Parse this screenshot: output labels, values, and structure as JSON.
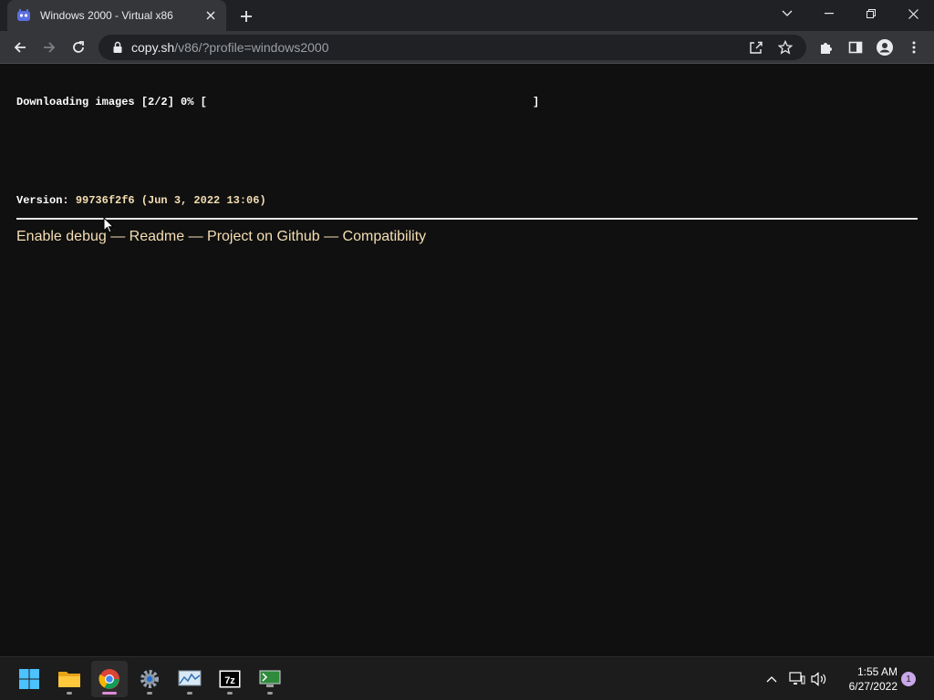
{
  "browser": {
    "tab": {
      "title": "Windows 2000 - Virtual x86",
      "favicon": "v86-icon"
    },
    "address": {
      "host": "copy.sh",
      "path": "/v86/?profile=windows2000"
    }
  },
  "page": {
    "status": "Downloading images [2/2] 0% [",
    "progress_end": "]",
    "progress_percent": 0,
    "version_label": "Version: ",
    "version_value": "99736f2f6 (Jun 3, 2022 13:06)",
    "links": [
      {
        "label": "Enable debug"
      },
      {
        "label": "Readme"
      },
      {
        "label": "Project on Github"
      },
      {
        "label": "Compatibility"
      }
    ],
    "separator": " — ",
    "colors": {
      "background": "#101010",
      "link": "#f5deb3",
      "text": "#ffffff"
    }
  },
  "taskbar": {
    "apps": [
      "windows-start",
      "file-explorer",
      "google-chrome",
      "settings",
      "resource-monitor",
      "7-zip",
      "terminal"
    ],
    "clock": {
      "time": "1:55 AM",
      "date": "6/27/2022"
    },
    "notifications": "1"
  }
}
